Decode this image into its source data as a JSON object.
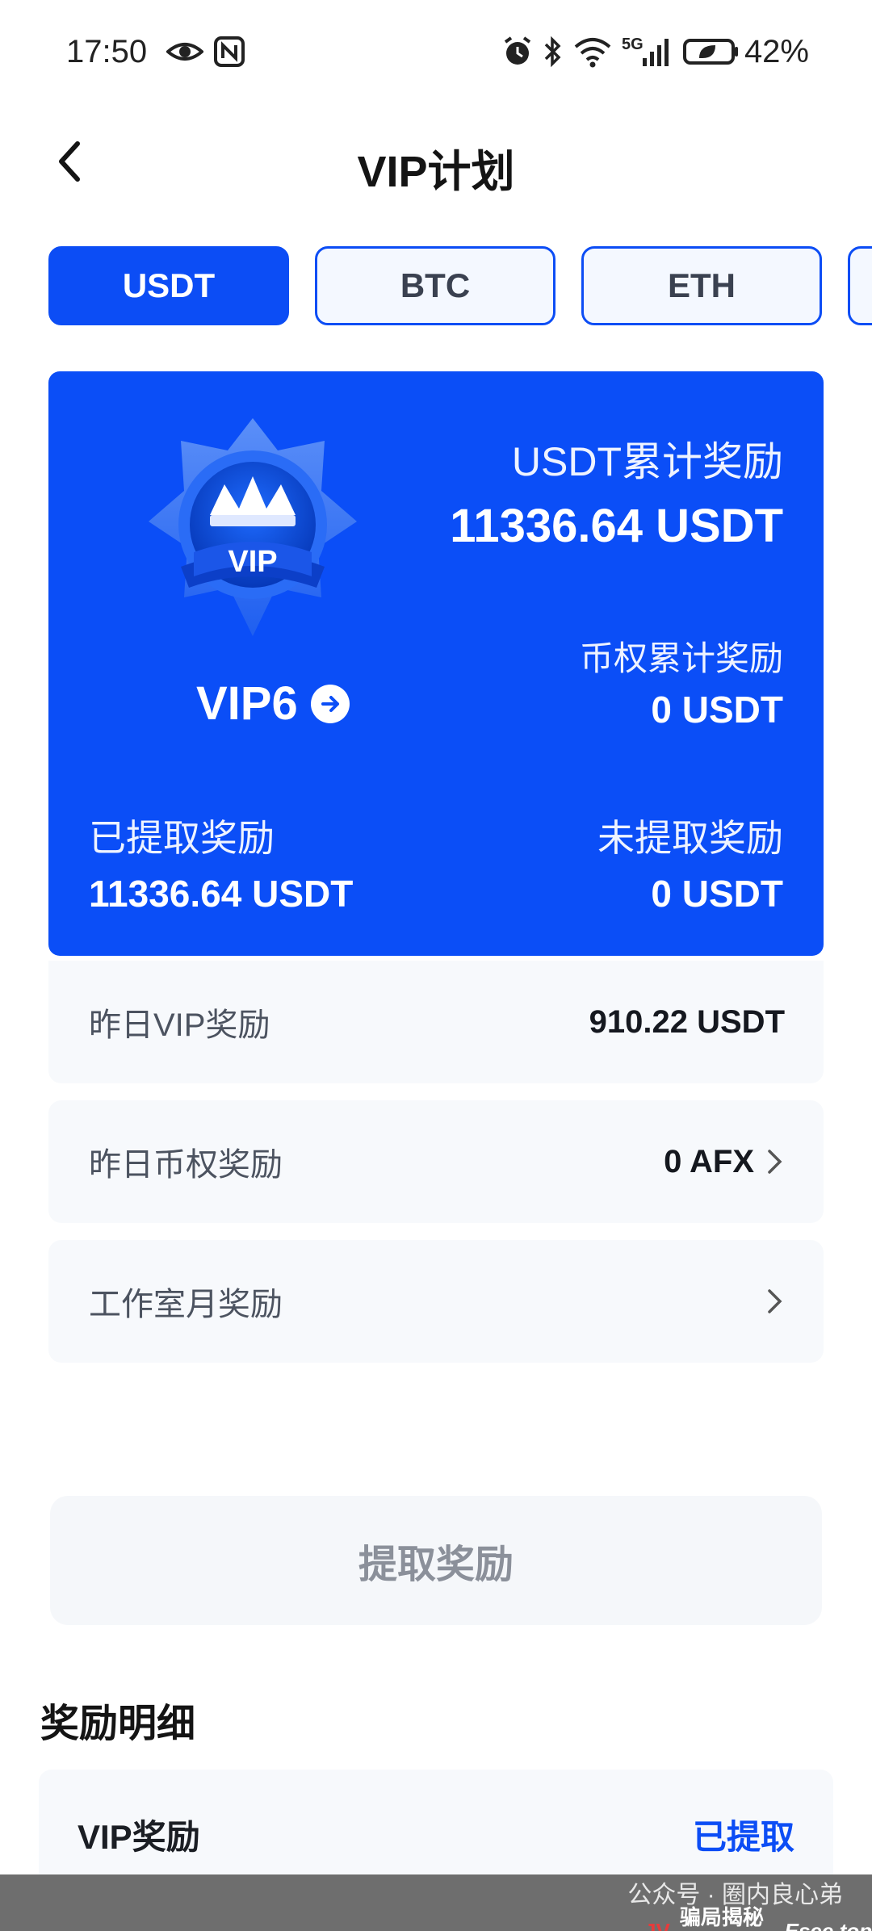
{
  "status_bar": {
    "time": "17:50",
    "network": "5G",
    "battery": "42%"
  },
  "header": {
    "title": "VIP计划"
  },
  "tabs": [
    {
      "label": "USDT",
      "active": true
    },
    {
      "label": "BTC",
      "active": false
    },
    {
      "label": "ETH",
      "active": false
    }
  ],
  "hero": {
    "badge_text": "VIP",
    "vip_level": "VIP6",
    "usdt_total_label": "USDT累计奖励",
    "usdt_total_value": "11336.64 USDT",
    "coin_total_label": "币权累计奖励",
    "coin_total_value": "0 USDT",
    "withdrawn_label": "已提取奖励",
    "withdrawn_value": "11336.64 USDT",
    "unwithdrawn_label": "未提取奖励",
    "unwithdrawn_value": "0 USDT"
  },
  "rows": [
    {
      "label": "昨日VIP奖励",
      "value": "910.22 USDT"
    },
    {
      "label": "昨日币权奖励",
      "value": "0 AFX"
    },
    {
      "label": "工作室月奖励",
      "value": ""
    }
  ],
  "withdraw_button": "提取奖励",
  "details": {
    "title": "奖励明细",
    "items": [
      {
        "label": "VIP奖励",
        "status": "已提取"
      }
    ]
  },
  "watermark": {
    "account": "公众号 · 圈内良心弟",
    "logo": "骗局揭秘网",
    "site": "Esee.top",
    "mark": "JV"
  },
  "colors": {
    "primary": "#0c4df5",
    "card_bg": "#0b4ef7",
    "row_bg": "#f7f9fc"
  }
}
